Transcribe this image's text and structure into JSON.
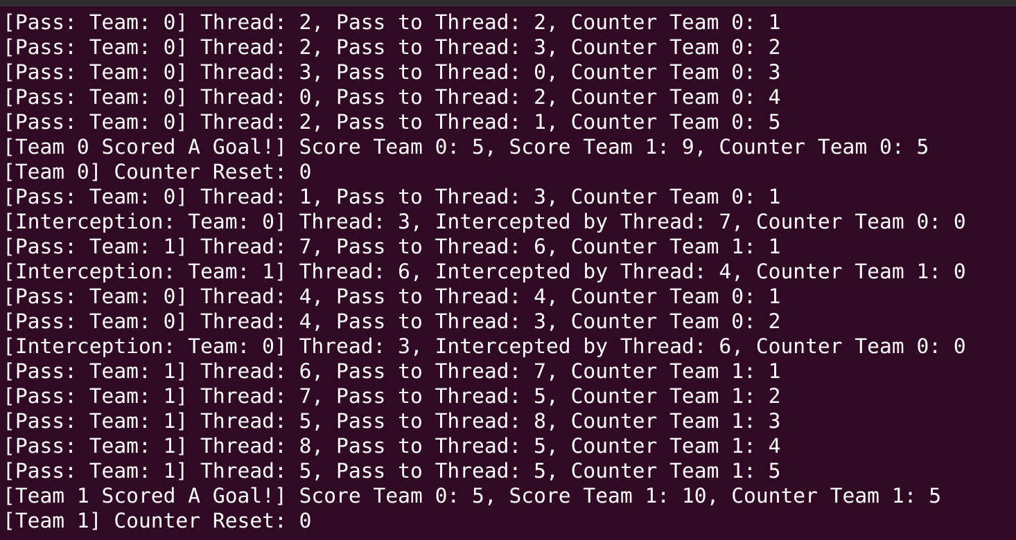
{
  "terminal": {
    "background": "#300a24",
    "foreground": "#ffffff",
    "lines": [
      "[Pass: Team: 0] Thread: 2, Pass to Thread: 2, Counter Team 0: 1",
      "[Pass: Team: 0] Thread: 2, Pass to Thread: 3, Counter Team 0: 2",
      "[Pass: Team: 0] Thread: 3, Pass to Thread: 0, Counter Team 0: 3",
      "[Pass: Team: 0] Thread: 0, Pass to Thread: 2, Counter Team 0: 4",
      "[Pass: Team: 0] Thread: 2, Pass to Thread: 1, Counter Team 0: 5",
      "[Team 0 Scored A Goal!] Score Team 0: 5, Score Team 1: 9, Counter Team 0: 5",
      "[Team 0] Counter Reset: 0",
      "[Pass: Team: 0] Thread: 1, Pass to Thread: 3, Counter Team 0: 1",
      "[Interception: Team: 0] Thread: 3, Intercepted by Thread: 7, Counter Team 0: 0",
      "[Pass: Team: 1] Thread: 7, Pass to Thread: 6, Counter Team 1: 1",
      "[Interception: Team: 1] Thread: 6, Intercepted by Thread: 4, Counter Team 1: 0",
      "[Pass: Team: 0] Thread: 4, Pass to Thread: 4, Counter Team 0: 1",
      "[Pass: Team: 0] Thread: 4, Pass to Thread: 3, Counter Team 0: 2",
      "[Interception: Team: 0] Thread: 3, Intercepted by Thread: 6, Counter Team 0: 0",
      "[Pass: Team: 1] Thread: 6, Pass to Thread: 7, Counter Team 1: 1",
      "[Pass: Team: 1] Thread: 7, Pass to Thread: 5, Counter Team 1: 2",
      "[Pass: Team: 1] Thread: 5, Pass to Thread: 8, Counter Team 1: 3",
      "[Pass: Team: 1] Thread: 8, Pass to Thread: 5, Counter Team 1: 4",
      "[Pass: Team: 1] Thread: 5, Pass to Thread: 5, Counter Team 1: 5",
      "[Team 1 Scored A Goal!] Score Team 0: 5, Score Team 1: 10, Counter Team 1: 5",
      "[Team 1] Counter Reset: 0"
    ]
  }
}
